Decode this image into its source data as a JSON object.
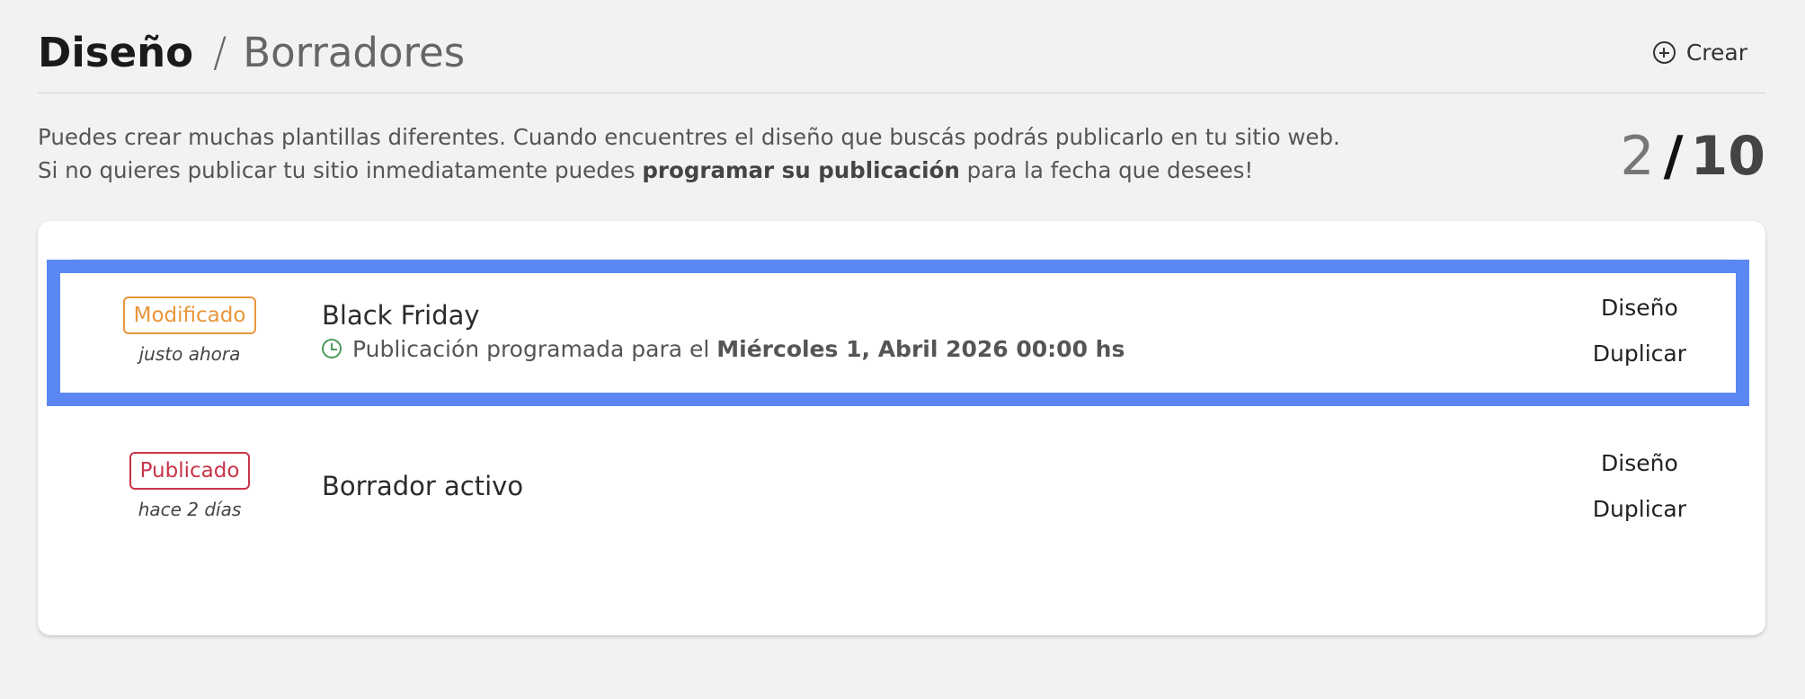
{
  "header": {
    "breadcrumb_current": "Diseño",
    "breadcrumb_separator": "/",
    "breadcrumb_page": "Borradores",
    "create_label": "Crear",
    "create_icon": "plus-circle-icon"
  },
  "description": {
    "line1": "Puedes crear muchas plantillas diferentes. Cuando encuentres el diseño que buscás podrás publicarlo en tu sitio web.",
    "line2_prefix": "Si no quieres publicar tu sitio inmediatamente puedes ",
    "line2_bold": "programar su publicación",
    "line2_suffix": " para la fecha que desees!"
  },
  "counter": {
    "used": "2",
    "separator": "/",
    "total": "10"
  },
  "drafts": [
    {
      "status": "Modificado",
      "status_color": "#e8963a",
      "time": "justo ahora",
      "title": "Black Friday",
      "schedule_icon": "clock-icon",
      "schedule_prefix": "Publicación programada para el ",
      "schedule_date": "Miércoles 1, Abril 2026 00:00 hs",
      "action_design": "Diseño",
      "action_duplicate": "Duplicar",
      "highlighted": true
    },
    {
      "status": "Publicado",
      "status_color": "#c9344a",
      "time": "hace 2 días",
      "title": "Borrador activo",
      "action_design": "Diseño",
      "action_duplicate": "Duplicar",
      "highlighted": false
    }
  ],
  "colors": {
    "highlight": "#5b87f5",
    "background": "#f2f2f2",
    "card": "#ffffff"
  }
}
